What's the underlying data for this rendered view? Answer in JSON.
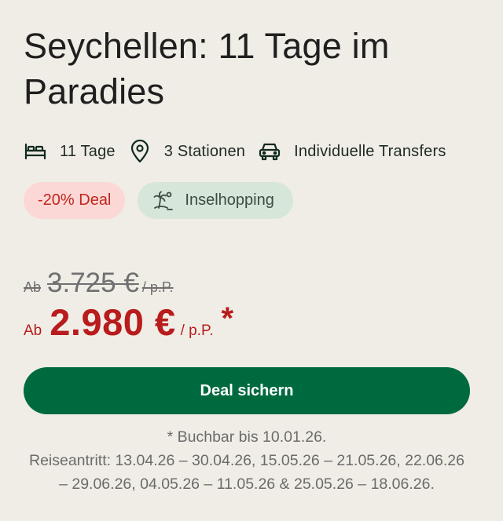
{
  "offer": {
    "title": "Seychellen: 11 Tage im Paradies",
    "features": [
      {
        "icon": "bed-icon",
        "label": "11 Tage"
      },
      {
        "icon": "location-pin-icon",
        "label": "3 Stationen"
      },
      {
        "icon": "car-icon",
        "label": "Individuelle Transfers"
      }
    ],
    "badges": {
      "deal": "-20% Deal",
      "theme": "Inselhopping",
      "theme_icon": "island-palm-icon"
    },
    "price_old": {
      "prefix": "Ab",
      "amount": "3.725 €",
      "per": "/ p.P."
    },
    "price_new": {
      "prefix": "Ab",
      "amount": "2.980 €",
      "per": "/ p.P.",
      "star": "*"
    },
    "cta_label": "Deal sichern",
    "booking_note": "* Buchbar bis 10.01.26.",
    "travel_dates": "Reiseantritt: 13.04.26 – 30.04.26, 15.05.26 – 21.05.26, 22.06.26 – 29.06.26, 04.05.26 – 11.05.26 & 25.05.26 – 18.06.26."
  },
  "colors": {
    "background": "#f0ede6",
    "accent_green": "#006a3f",
    "price_red": "#b81c1c",
    "deal_badge_bg": "#fbd8d6",
    "theme_badge_bg": "#d6e6d8"
  }
}
